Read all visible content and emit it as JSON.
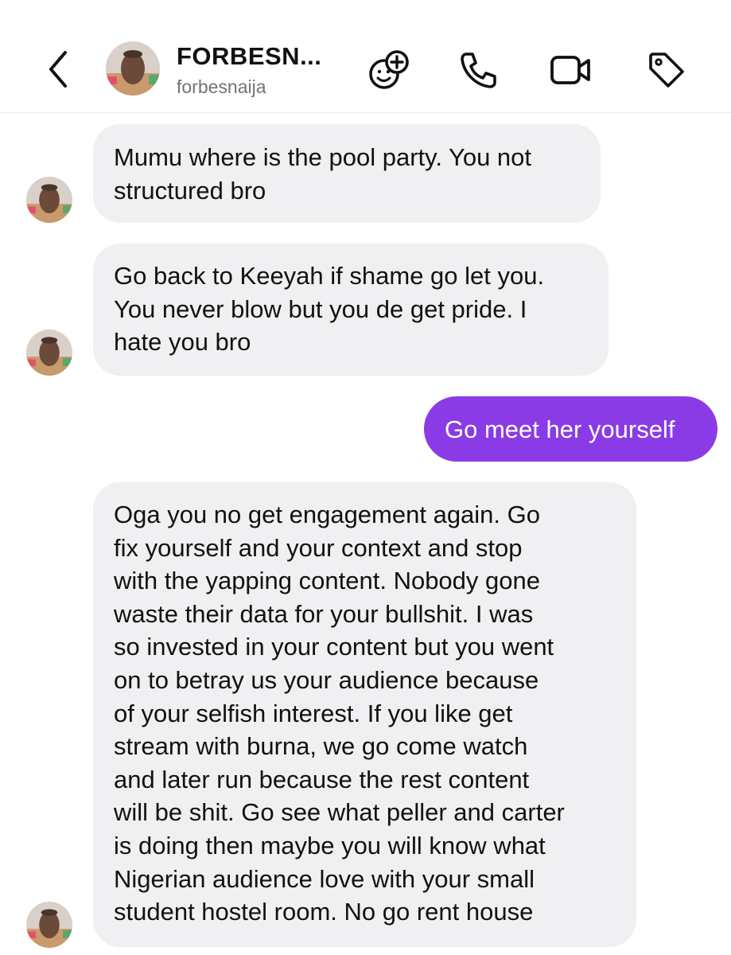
{
  "header": {
    "display_name": "FORBESN...",
    "username": "forbesnaija",
    "icons": [
      "chevron-left-icon",
      "add-sticker-icon",
      "phone-icon",
      "video-camera-icon",
      "tag-icon"
    ]
  },
  "colors": {
    "outgoing_bubble": "#8a3be6",
    "incoming_bubble": "#f0f0f3",
    "muted_text": "#737373"
  },
  "messages": [
    {
      "direction": "incoming",
      "text": "Mumu where is the pool party. You not\nstructured bro"
    },
    {
      "direction": "incoming",
      "text": "Go back to Keeyah if shame go let you.\nYou never blow but you de get pride. I\nhate you bro"
    },
    {
      "direction": "outgoing",
      "text": "Go meet her yourself"
    },
    {
      "direction": "incoming",
      "text": "Oga you no get engagement again. Go\nfix yourself and your context and stop\nwith the yapping content. Nobody gone\nwaste their data for your bullshit. I was\nso invested in your content but you went\non to betray us your audience because\nof your selfish interest. If you like get\nstream with burna, we go come watch\nand later run because the rest content\nwill be shit. Go see what peller and carter\nis doing then maybe you will know what\nNigerian audience love with your small\nstudent hostel room. No go rent house"
    }
  ]
}
